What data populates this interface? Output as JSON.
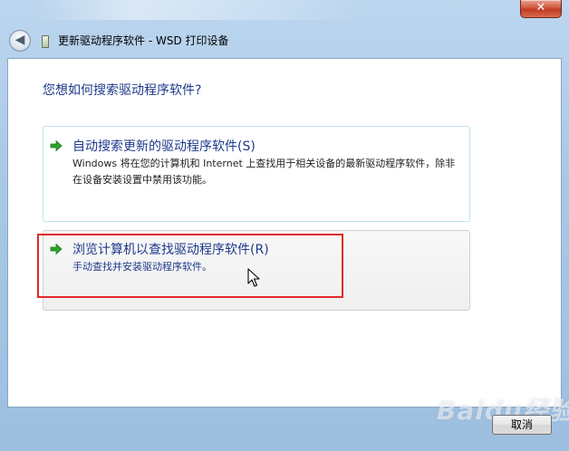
{
  "window": {
    "title": "更新驱动程序软件 - WSD 打印设备",
    "close_glyph": "✕",
    "back_glyph": "◀"
  },
  "main": {
    "question": "您想如何搜索驱动程序软件?",
    "options": [
      {
        "title": "自动搜索更新的驱动程序软件(S)",
        "description": "Windows 将在您的计算机和 Internet 上查找用于相关设备的最新驱动程序软件，除非在设备安装设置中禁用该功能。",
        "icon": "green-arrow-icon"
      },
      {
        "title": "浏览计算机以查找驱动程序软件(R)",
        "description": "手动查找并安装驱动程序软件。",
        "icon": "green-arrow-icon"
      }
    ]
  },
  "footer": {
    "cancel_label": "取消"
  },
  "watermark": {
    "text": "Baidu经验"
  },
  "colors": {
    "accent": "#1e3a8a",
    "highlight": "#e12b2b",
    "arrow": "#2aa52a"
  }
}
